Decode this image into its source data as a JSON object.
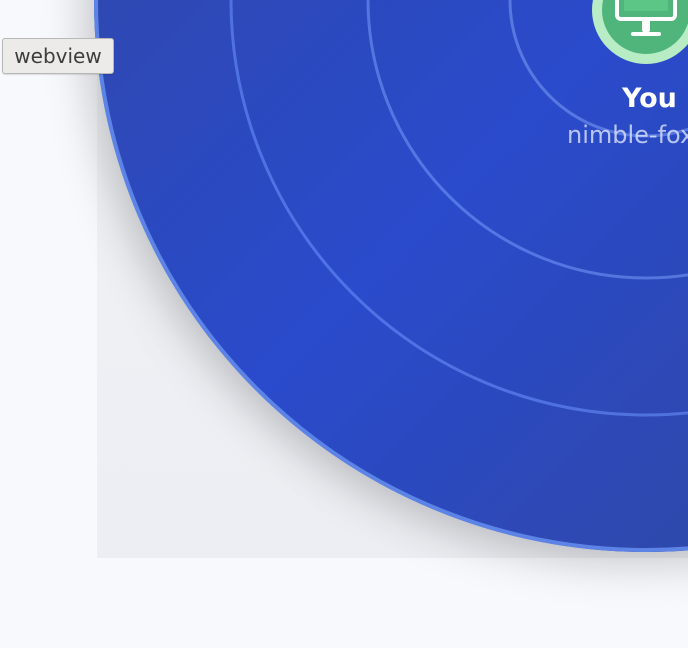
{
  "overlay": {
    "webview_label": "webview"
  },
  "radar": {
    "self": {
      "label": "You",
      "device_name": "nimble-fox",
      "icon": "monitor-icon",
      "icon_color": "#4fb57a",
      "ring_color": "#b8ecc5"
    },
    "colors": {
      "panel": "#2a4bcc",
      "panel_dark": "#2f3f8f",
      "rim": "#5f87e8"
    }
  }
}
